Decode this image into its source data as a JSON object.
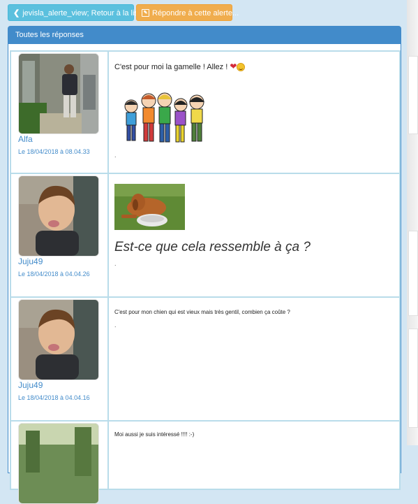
{
  "toolbar": {
    "back_label": "jevisla_alerte_view; Retour à la liste",
    "reply_label": "Répondre à cette alerte..."
  },
  "panel": {
    "title": "Toutes les réponses"
  },
  "posts": [
    {
      "author": "Alfa",
      "date": "Le 18/04/2018 à 08.04.33",
      "text": "C'est pour moi la gamelle !  Allez ! ",
      "tail": "."
    },
    {
      "author": "Juju49",
      "date": "Le 18/04/2018 à 04.04.26",
      "text": "Est-ce que cela ressemble à ça ?",
      "tail": "."
    },
    {
      "author": "Juju49",
      "date": "Le 18/04/2018 à 04.04.16",
      "text": "C'est pour mon chien qui est vieux mais très gentil, combien ça coûte ?",
      "tail": "."
    },
    {
      "author": "",
      "date": "",
      "text": "Moi aussi je suis intéressé !!!!    :-)",
      "tail": ""
    }
  ],
  "colors": {
    "primary": "#428bca",
    "info": "#5bc0de",
    "warning": "#f0ad4e",
    "row_border": "#b9dcea"
  },
  "icons": {
    "back": "chevron-left-icon",
    "reply": "edit-icon",
    "heart": "heart-icon",
    "smiley": "smiley-icon"
  }
}
